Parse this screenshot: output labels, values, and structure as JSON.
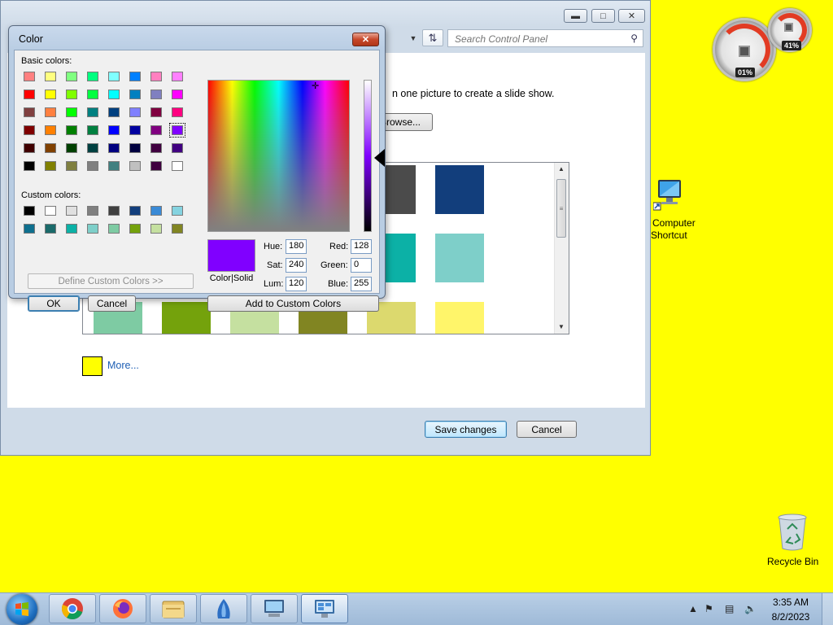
{
  "control_panel": {
    "search_placeholder": "Search Control Panel",
    "description": "n one picture to create a slide show.",
    "browse_label": "Browse...",
    "swatches": [
      {
        "color": "#4b4b4b"
      },
      {
        "color": "#123e7c"
      },
      {
        "color": "#0cb1a6"
      },
      {
        "color": "#7ecfc9"
      },
      {
        "color": "#7ecba3"
      },
      {
        "color": "#74a20c"
      },
      {
        "color": "#c5e0a0"
      },
      {
        "color": "#818522"
      },
      {
        "color": "#dcd96e"
      },
      {
        "color": "#fff56a"
      }
    ],
    "more_label": "More...",
    "more_color": "#ffff00",
    "save_label": "Save changes",
    "cancel_label": "Cancel"
  },
  "color_dialog": {
    "title": "Color",
    "basic_colors_label": "Basic colors:",
    "basic_colors": [
      [
        "#ff8080",
        "#ffff80",
        "#80ff80",
        "#00ff80",
        "#80ffff",
        "#0080ff",
        "#ff80c0",
        "#ff80ff"
      ],
      [
        "#ff0000",
        "#ffff00",
        "#80ff00",
        "#00ff40",
        "#00ffff",
        "#0080c0",
        "#8080c0",
        "#ff00ff"
      ],
      [
        "#804040",
        "#ff8040",
        "#00ff00",
        "#008080",
        "#004080",
        "#8080ff",
        "#800040",
        "#ff0080"
      ],
      [
        "#800000",
        "#ff8000",
        "#008000",
        "#008040",
        "#0000ff",
        "#0000a0",
        "#800080",
        "#8000ff"
      ],
      [
        "#400000",
        "#804000",
        "#004000",
        "#004040",
        "#000080",
        "#000040",
        "#400040",
        "#400080"
      ],
      [
        "#000000",
        "#808000",
        "#808040",
        "#808080",
        "#408080",
        "#c0c0c0",
        "#400040",
        "#ffffff"
      ]
    ],
    "selected_basic": {
      "row": 3,
      "col": 7
    },
    "custom_colors_label": "Custom colors:",
    "custom_colors": [
      [
        "#000000",
        "#ffffff",
        "#e0e0e0",
        "#808080",
        "#404040",
        "#123e7c",
        "#3a8ad6",
        "#85d3e0"
      ],
      [
        "#0e6f8e",
        "#1a6a6a",
        "#0cb1a6",
        "#7ecfc9",
        "#7ecba3",
        "#74a20c",
        "#c5e0a0",
        "#818522"
      ]
    ],
    "define_label": "Define Custom Colors >>",
    "ok_label": "OK",
    "cancel_label": "Cancel",
    "color_solid_label": "Color|Solid",
    "preview_color": "#8000ff",
    "fields": {
      "hue_label": "Hue:",
      "hue": "180",
      "sat_label": "Sat:",
      "sat": "240",
      "lum_label": "Lum:",
      "lum": "120",
      "red_label": "Red:",
      "red": "128",
      "green_label": "Green:",
      "green": "0",
      "blue_label": "Blue:",
      "blue": "255"
    },
    "add_custom_label": "Add to Custom Colors"
  },
  "gadget": {
    "cpu_readout": "01%",
    "memory_readout": "41%"
  },
  "desktop": {
    "computer_label_line1": "Computer",
    "computer_label_line2": "Shortcut",
    "recycle_label": "Recycle Bin",
    "background_color": "#ffff00"
  },
  "taskbar": {
    "items": [
      {
        "name": "chrome-icon"
      },
      {
        "name": "firefox-icon"
      },
      {
        "name": "file-explorer-icon"
      },
      {
        "name": "app-icon"
      },
      {
        "name": "remote-desktop-icon"
      },
      {
        "name": "control-panel-icon"
      }
    ],
    "time": "3:35 AM",
    "date": "8/2/2023"
  }
}
